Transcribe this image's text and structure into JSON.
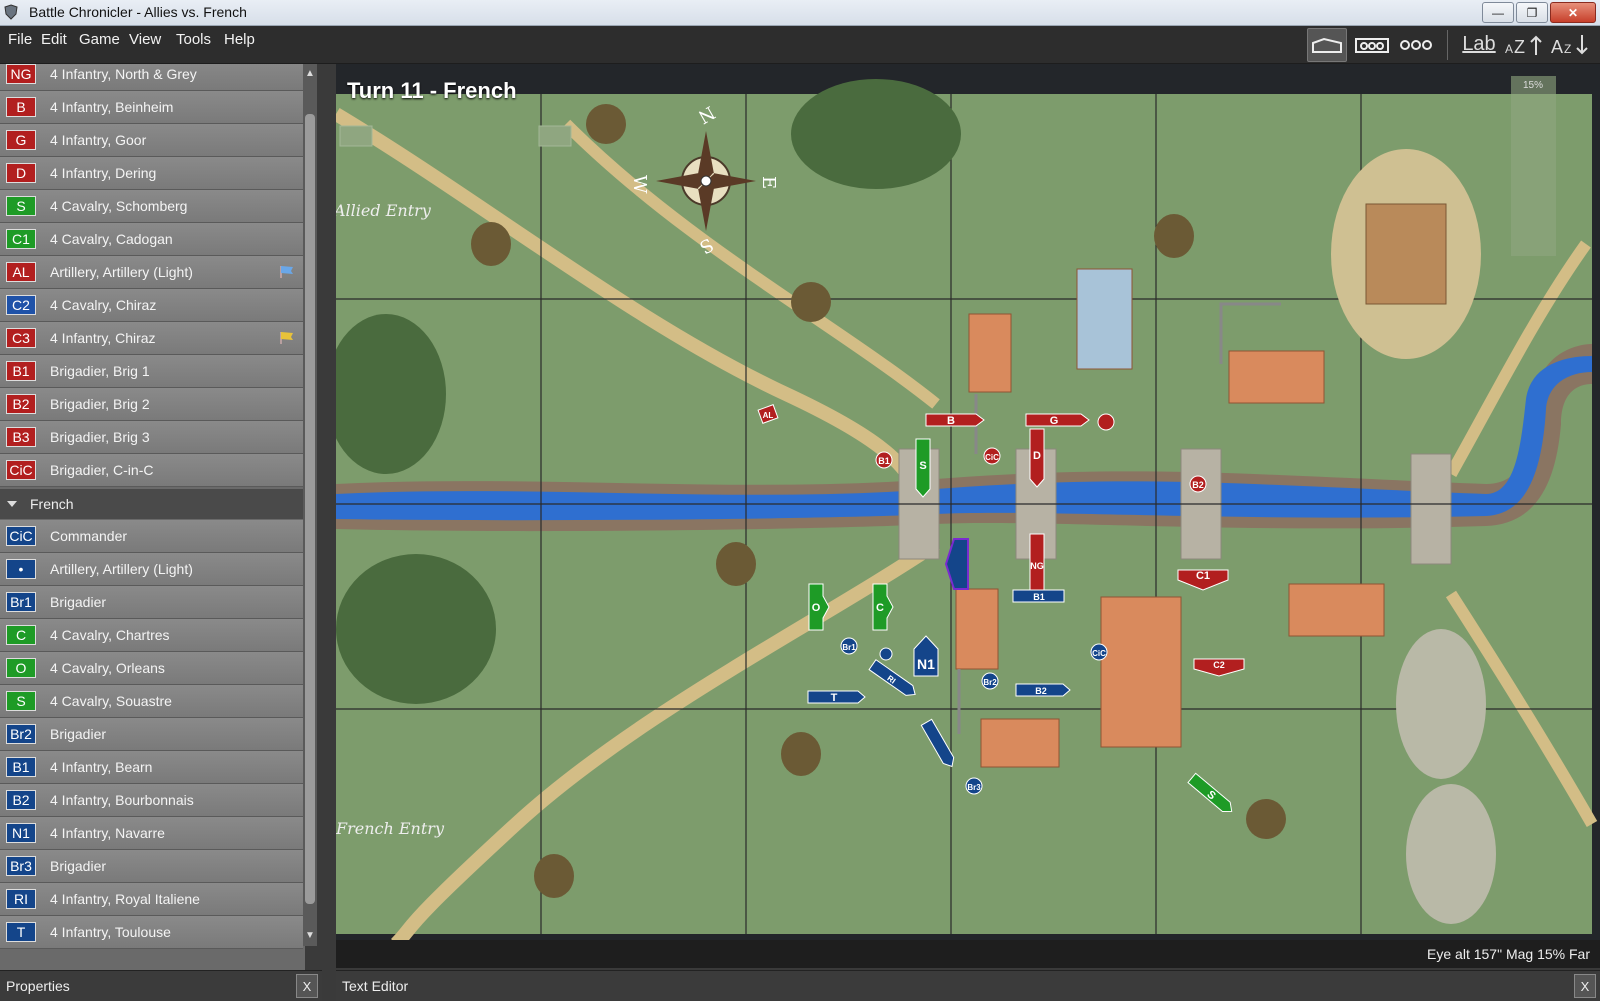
{
  "window": {
    "title": "Battle Chronicler - Allies vs. French"
  },
  "menu": [
    "File",
    "Edit",
    "Game",
    "View",
    "Tools",
    "Help"
  ],
  "toolbar": {
    "lab_label": "Lab"
  },
  "allied_units": [
    {
      "code": "NG",
      "label": "4 Infantry, North & Grey",
      "color": "red"
    },
    {
      "code": "B",
      "label": "4 Infantry, Beinheim",
      "color": "red"
    },
    {
      "code": "G",
      "label": "4 Infantry, Goor",
      "color": "red"
    },
    {
      "code": "D",
      "label": "4 Infantry, Dering",
      "color": "red"
    },
    {
      "code": "S",
      "label": "4 Cavalry, Schomberg",
      "color": "green"
    },
    {
      "code": "C1",
      "label": "4 Cavalry, Cadogan",
      "color": "green"
    },
    {
      "code": "AL",
      "label": "Artillery, Artillery (Light)",
      "color": "red",
      "flag": "blue"
    },
    {
      "code": "C2",
      "label": "4 Cavalry, Chiraz",
      "color": "blue2"
    },
    {
      "code": "C3",
      "label": "4 Infantry, Chiraz",
      "color": "red",
      "flag": "yellow"
    },
    {
      "code": "B1",
      "label": "Brigadier, Brig 1",
      "color": "red"
    },
    {
      "code": "B2",
      "label": "Brigadier, Brig 2",
      "color": "red"
    },
    {
      "code": "B3",
      "label": "Brigadier, Brig 3",
      "color": "red"
    },
    {
      "code": "CiC",
      "label": "Brigadier, C-in-C",
      "color": "red"
    }
  ],
  "french_group": {
    "label": "French"
  },
  "french_units": [
    {
      "code": "CiC",
      "label": "Commander",
      "color": "blue"
    },
    {
      "code": "•",
      "label": "Artillery, Artillery (Light)",
      "color": "blue"
    },
    {
      "code": "Br1",
      "label": "Brigadier",
      "color": "blue"
    },
    {
      "code": "C",
      "label": "4 Cavalry, Chartres",
      "color": "green"
    },
    {
      "code": "O",
      "label": "4 Cavalry, Orleans",
      "color": "green"
    },
    {
      "code": "S",
      "label": "4 Cavalry, Souastre",
      "color": "green"
    },
    {
      "code": "Br2",
      "label": "Brigadier",
      "color": "blue"
    },
    {
      "code": "B1",
      "label": "4 Infantry, Bearn",
      "color": "blue"
    },
    {
      "code": "B2",
      "label": "4 Infantry, Bourbonnais",
      "color": "blue"
    },
    {
      "code": "N1",
      "label": "4 Infantry, Navarre",
      "color": "blue"
    },
    {
      "code": "Br3",
      "label": "Brigadier",
      "color": "blue"
    },
    {
      "code": "RI",
      "label": "4 Infantry, Royal Italiene",
      "color": "blue"
    },
    {
      "code": "T",
      "label": "4 Infantry, Toulouse",
      "color": "blue"
    }
  ],
  "map": {
    "turn_title": "Turn 11 - French",
    "allied_entry": "Allied Entry",
    "french_entry": "French Entry",
    "zoom_label": "15%",
    "compass": [
      "N",
      "E",
      "S",
      "W"
    ],
    "markers": {
      "red": [
        "B",
        "G",
        "D",
        "S",
        "B1",
        "B2",
        "CiC",
        "AL",
        "C1",
        "C2",
        "NG"
      ],
      "blue": [
        "N1",
        "B1",
        "B2",
        "Br2",
        "Br1",
        "CiC",
        "T",
        "O",
        "C",
        "S",
        "RI",
        "Br3"
      ]
    }
  },
  "status": {
    "text": "Eye alt 157\"  Mag 15% Far"
  },
  "panels": {
    "properties": "Properties",
    "text_editor": "Text Editor",
    "close": "X"
  },
  "colors": {
    "allied_red": "#b21f1f",
    "french_blue": "#14458a",
    "cavalry_green": "#1e9b26",
    "grass": "#7fa06a",
    "river": "#2f6fd0",
    "road": "#d8c38e"
  }
}
